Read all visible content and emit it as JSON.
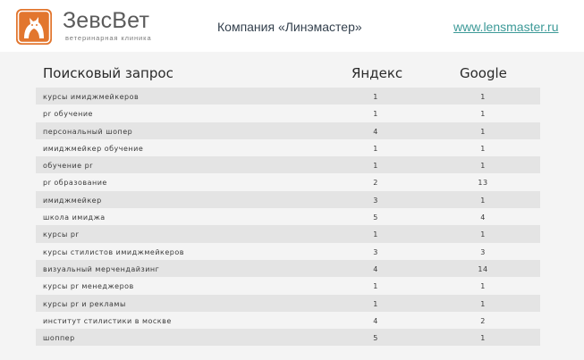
{
  "header": {
    "logo_name": "ЗевсВет",
    "logo_subtitle": "ветеринарная клиника",
    "company": "Компания «Линэмастер»",
    "site": "www.lensmaster.ru",
    "colors": {
      "logo_orange": "#e2762e",
      "link": "#3d9a98"
    }
  },
  "table": {
    "headers": {
      "query": "Поисковый запрос",
      "yandex": "Яндекс",
      "google": "Google"
    },
    "rows": [
      {
        "query": "курсы имиджмейкеров",
        "yandex": "1",
        "google": "1"
      },
      {
        "query": "pr обучение",
        "yandex": "1",
        "google": "1"
      },
      {
        "query": "персональный шопер",
        "yandex": "4",
        "google": "1"
      },
      {
        "query": "имиджмейкер обучение",
        "yandex": "1",
        "google": "1"
      },
      {
        "query": "обучение pr",
        "yandex": "1",
        "google": "1"
      },
      {
        "query": "pr образование",
        "yandex": "2",
        "google": "13"
      },
      {
        "query": "имиджмейкер",
        "yandex": "3",
        "google": "1"
      },
      {
        "query": "школа имиджа",
        "yandex": "5",
        "google": "4"
      },
      {
        "query": "курсы pr",
        "yandex": "1",
        "google": "1"
      },
      {
        "query": "курсы стилистов имиджмейкеров",
        "yandex": "3",
        "google": "3"
      },
      {
        "query": "визуальный мерчендайзинг",
        "yandex": "4",
        "google": "14"
      },
      {
        "query": "курсы pr менеджеров",
        "yandex": "1",
        "google": "1"
      },
      {
        "query": "курсы pr и рекламы",
        "yandex": "1",
        "google": "1"
      },
      {
        "query": "институт стилистики в москве",
        "yandex": "4",
        "google": "2"
      },
      {
        "query": "шоппер",
        "yandex": "5",
        "google": "1"
      }
    ]
  }
}
